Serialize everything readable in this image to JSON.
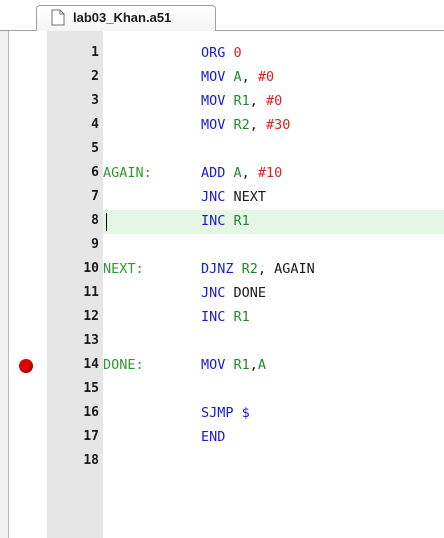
{
  "tab": {
    "label": "lab03_Khan.a51",
    "icon": "document-icon"
  },
  "editor": {
    "current_line": 8,
    "breakpoint_line": 14,
    "colors": {
      "label": "#2e9a2e",
      "mnemonic": "#1a1acc",
      "register": "#1f8a2d",
      "number": "#e02020",
      "current_line_highlight": "#e5f6e6",
      "gutter": "#e6e6e6",
      "breakpoint": "#e00000"
    },
    "lines": [
      {
        "num": "1",
        "label": "",
        "mnemonic": "ORG",
        "operands": [
          {
            "t": "num",
            "v": "0"
          }
        ]
      },
      {
        "num": "2",
        "label": "",
        "mnemonic": "MOV",
        "operands": [
          {
            "t": "reg",
            "v": "A"
          },
          {
            "t": "sym",
            "v": ", "
          },
          {
            "t": "num",
            "v": "#0"
          }
        ]
      },
      {
        "num": "3",
        "label": "",
        "mnemonic": "MOV",
        "operands": [
          {
            "t": "reg",
            "v": "R1"
          },
          {
            "t": "sym",
            "v": ", "
          },
          {
            "t": "num",
            "v": "#0"
          }
        ]
      },
      {
        "num": "4",
        "label": "",
        "mnemonic": "MOV",
        "operands": [
          {
            "t": "reg",
            "v": "R2"
          },
          {
            "t": "sym",
            "v": ", "
          },
          {
            "t": "num",
            "v": "#30"
          }
        ]
      },
      {
        "num": "5",
        "label": "",
        "mnemonic": "",
        "operands": []
      },
      {
        "num": "6",
        "label": "AGAIN:",
        "mnemonic": "ADD",
        "operands": [
          {
            "t": "reg",
            "v": "A"
          },
          {
            "t": "sym",
            "v": ", "
          },
          {
            "t": "num",
            "v": "#10"
          }
        ]
      },
      {
        "num": "7",
        "label": "",
        "mnemonic": "JNC",
        "operands": [
          {
            "t": "plain",
            "v": "NEXT"
          }
        ]
      },
      {
        "num": "8",
        "label": "",
        "mnemonic": "INC",
        "operands": [
          {
            "t": "reg",
            "v": "R1"
          }
        ]
      },
      {
        "num": "9",
        "label": "",
        "mnemonic": "",
        "operands": []
      },
      {
        "num": "10",
        "label": "NEXT:",
        "mnemonic": "DJNZ",
        "operands": [
          {
            "t": "reg",
            "v": "R2"
          },
          {
            "t": "sym",
            "v": ", "
          },
          {
            "t": "plain",
            "v": "AGAIN"
          }
        ]
      },
      {
        "num": "11",
        "label": "",
        "mnemonic": "JNC",
        "operands": [
          {
            "t": "plain",
            "v": "DONE"
          }
        ]
      },
      {
        "num": "12",
        "label": "",
        "mnemonic": "INC",
        "operands": [
          {
            "t": "reg",
            "v": "R1"
          }
        ]
      },
      {
        "num": "13",
        "label": "",
        "mnemonic": "",
        "operands": []
      },
      {
        "num": "14",
        "label": "DONE:",
        "mnemonic": "MOV",
        "operands": [
          {
            "t": "reg",
            "v": "R1"
          },
          {
            "t": "sym",
            "v": ","
          },
          {
            "t": "reg",
            "v": "A"
          }
        ]
      },
      {
        "num": "15",
        "label": "",
        "mnemonic": "",
        "operands": []
      },
      {
        "num": "16",
        "label": "",
        "mnemonic": "SJMP",
        "operands": [
          {
            "t": "dollar",
            "v": "$"
          }
        ]
      },
      {
        "num": "17",
        "label": "",
        "mnemonic": "END",
        "operands": []
      },
      {
        "num": "18",
        "label": "",
        "mnemonic": "",
        "operands": []
      }
    ]
  }
}
